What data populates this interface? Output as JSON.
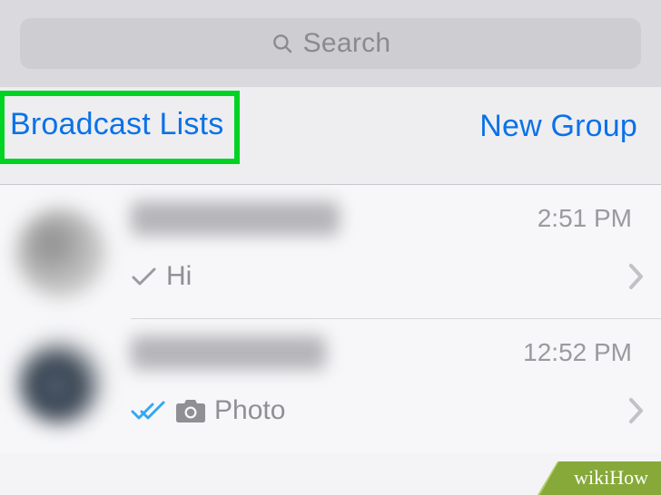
{
  "search": {
    "placeholder": "Search"
  },
  "links": {
    "broadcast": "Broadcast Lists",
    "new_group": "New Group"
  },
  "chats": [
    {
      "time": "2:51 PM",
      "status": "sent_single",
      "preview_text": "Hi",
      "has_camera": false
    },
    {
      "time": "12:52 PM",
      "status": "read_double",
      "preview_text": "Photo",
      "has_camera": true
    }
  ],
  "watermark": "wikiHow",
  "colors": {
    "ios_blue": "#0b72e7",
    "highlight_green": "#00d321",
    "read_blue": "#34a7f2"
  }
}
